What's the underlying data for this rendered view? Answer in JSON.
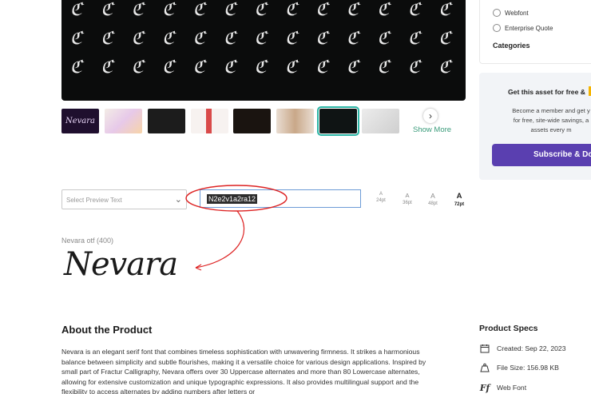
{
  "preview": {
    "glyph_rows": [
      "ℭ ℭ ℭ ℭ ℭ ℭ ℭ ℭ ℭ ℭ ℭ ℭ ℭ",
      "ℭ ℭ ℭ ℭ ℭ ℭ ℭ ℭ ℭ ℭ ℭ ℭ ℭ",
      "ℭ ℭ ℭ ℭ ℭ ℭ ℭ ℭ ℭ ℭ ℭ ℭ ℭ"
    ]
  },
  "thumbnails": {
    "show_more": "Show More",
    "items": [
      {
        "label": "Nevara",
        "bg": "#1f0f2e"
      },
      {
        "label": "",
        "bg": "#f3ece6"
      },
      {
        "label": "",
        "bg": "#1c1c1c"
      },
      {
        "label": "",
        "bg": "#f7f2f0"
      },
      {
        "label": "",
        "bg": "#1a1410"
      },
      {
        "label": "",
        "bg": "#e9ddd2"
      },
      {
        "label": "",
        "bg": "#0f1414"
      },
      {
        "label": "",
        "bg": "#ececec"
      }
    ]
  },
  "controls": {
    "select_placeholder": "Select Preview Text",
    "preview_text": "N2e2v1a2ra12",
    "sizes": [
      {
        "label": "A",
        "pt": "24pt"
      },
      {
        "label": "A",
        "pt": "36pt"
      },
      {
        "label": "A",
        "pt": "48pt"
      },
      {
        "label": "A",
        "pt": "72pt"
      }
    ],
    "active_size": "72pt"
  },
  "sample": {
    "font_name": "Nevara otf (400)",
    "text": "Nevara"
  },
  "about": {
    "title": "About the Product",
    "text": "Nevara is an elegant serif font that combines timeless sophistication with unwavering firmness. It strikes a harmonious balance between simplicity and subtle flourishes, making it a versatile choice for various design applications. Inspired by small part of Fractur Calligraphy, Nevara offers over 30 Uppercase alternates and more than 80 Lowercase alternates, allowing for extensive customization and unique typographic expressions. It also provides multilingual support and the flexibility to access alternates by adding numbers after letters or"
  },
  "sidebar": {
    "license_options": [
      "Webfont",
      "Enterprise Quote"
    ],
    "categories": "Categories",
    "promo": {
      "title": "Get this asset for free &",
      "lines": [
        "Become a member and get y",
        "for free, site-wide savings, a",
        "assets every m"
      ],
      "button": "Subscribe & Do",
      "accent": "#f5b400",
      "button_color": "#5a3fb0"
    },
    "specs": {
      "title": "Product Specs",
      "created": "Created: Sep 22, 2023",
      "file_size": "File Size: 156.98 KB",
      "type": "Web Font"
    }
  }
}
